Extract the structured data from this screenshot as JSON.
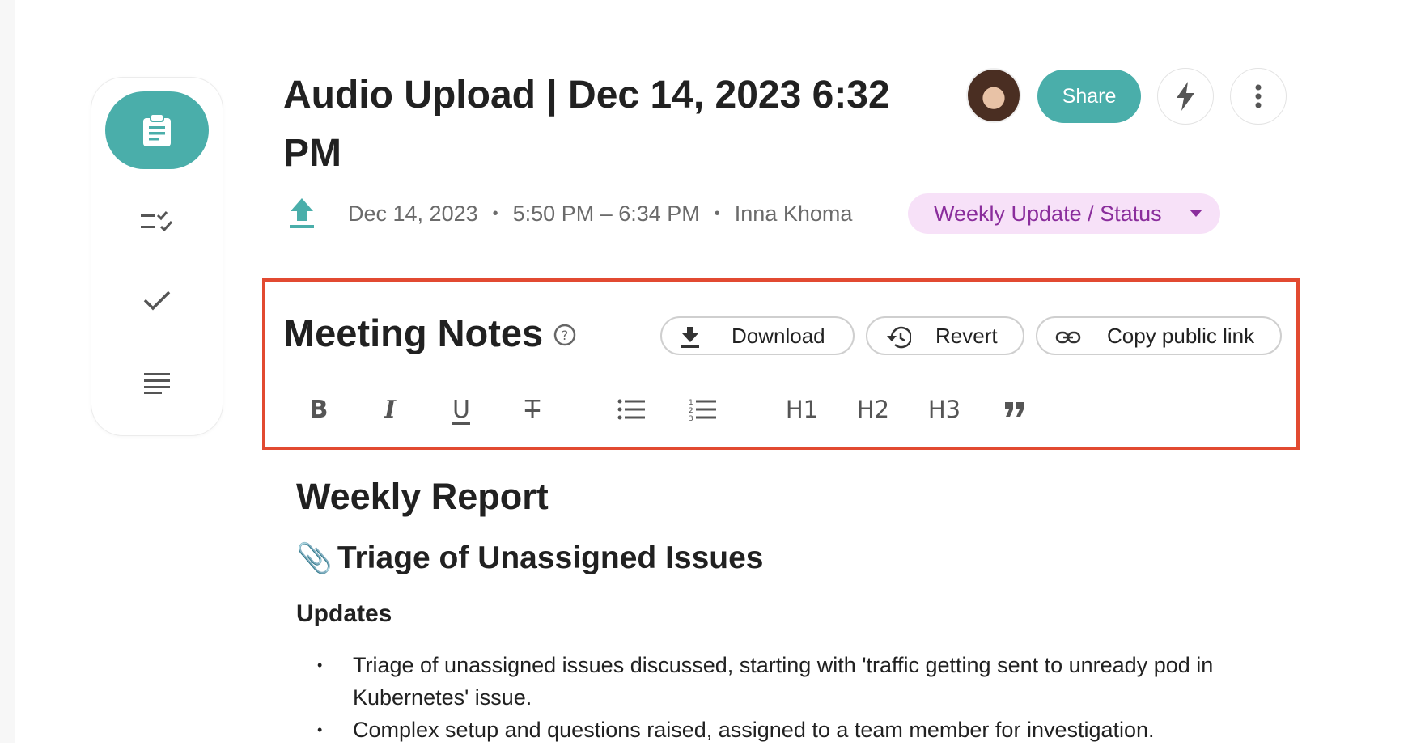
{
  "header": {
    "title": "Audio Upload | Dec 14, 2023 6:32 PM",
    "share_label": "Share",
    "avatar_icon": "user-avatar",
    "action_icons": [
      "lightning-icon",
      "more-vertical-icon"
    ]
  },
  "meta": {
    "source_icon": "upload-icon",
    "date": "Dec 14, 2023",
    "separator": "•",
    "time_range": "5:50 PM – 6:34 PM",
    "author": "Inna Khoma",
    "template_label": "Weekly Update / Status"
  },
  "sidebar": {
    "items": [
      {
        "icon": "clipboard-icon",
        "active": true
      },
      {
        "icon": "checklist-icon",
        "active": false
      },
      {
        "icon": "checkmark-icon",
        "active": false
      },
      {
        "icon": "transcript-lines-icon",
        "active": false
      }
    ]
  },
  "notes": {
    "title": "Meeting Notes",
    "download_label": "Download",
    "revert_label": "Revert",
    "copy_link_label": "Copy public link",
    "format_tools": {
      "bold": "B",
      "italic": "I",
      "underline": "U",
      "strike": "T",
      "h1": "H1",
      "h2": "H2",
      "h3": "H3"
    }
  },
  "content": {
    "heading": "Weekly Report",
    "section_title": "Triage of Unassigned Issues",
    "section_emoji": "📎",
    "subheading": "Updates",
    "bullets": [
      "Triage of unassigned issues discussed, starting with 'traffic getting sent to unready pod in Kubernetes' issue.",
      "Complex setup and questions raised, assigned to a team member for investigation."
    ]
  },
  "colors": {
    "accent": "#4aaeaa",
    "tag_bg": "#f7e1f8",
    "tag_text": "#8a2d9c",
    "highlight_border": "#e24a31"
  }
}
